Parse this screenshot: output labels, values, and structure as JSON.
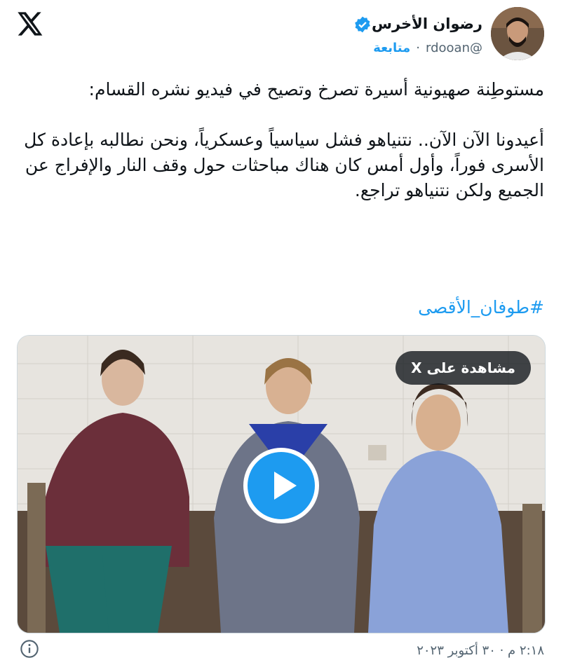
{
  "author": {
    "name": "رضوان الأخرس",
    "handle": "@rdooan",
    "separator": "·",
    "follow_label": "متابعة",
    "verified": true
  },
  "tweet": {
    "text": "مستوطِنة صهيونية أسيرة تصرخ وتصيح في فيديو نشره القسام:\n\nأعيدونا الآن الآن.. نتنياهو فشل سياسياً وعسكرياً، ونحن نطالبه بإعادة كل الأسرى فوراً، وأول أمس كان هناك مباحثات حول وقف النار والإفراج عن الجميع ولكن نتنياهو تراجع.",
    "hashtag": "#طوفان_الأقصى",
    "timestamp": "٢:١٨ م · ٣٠ أكتوبر ٢٠٢٣"
  },
  "media": {
    "watch_label": "مشاهدة على X",
    "type": "video"
  },
  "icons": {
    "logo": "x-logo-icon",
    "verified": "verified-badge-icon",
    "play": "play-icon",
    "info": "info-icon"
  },
  "colors": {
    "accent": "#1d9bf0",
    "text": "#0f1419",
    "secondary": "#536471"
  }
}
